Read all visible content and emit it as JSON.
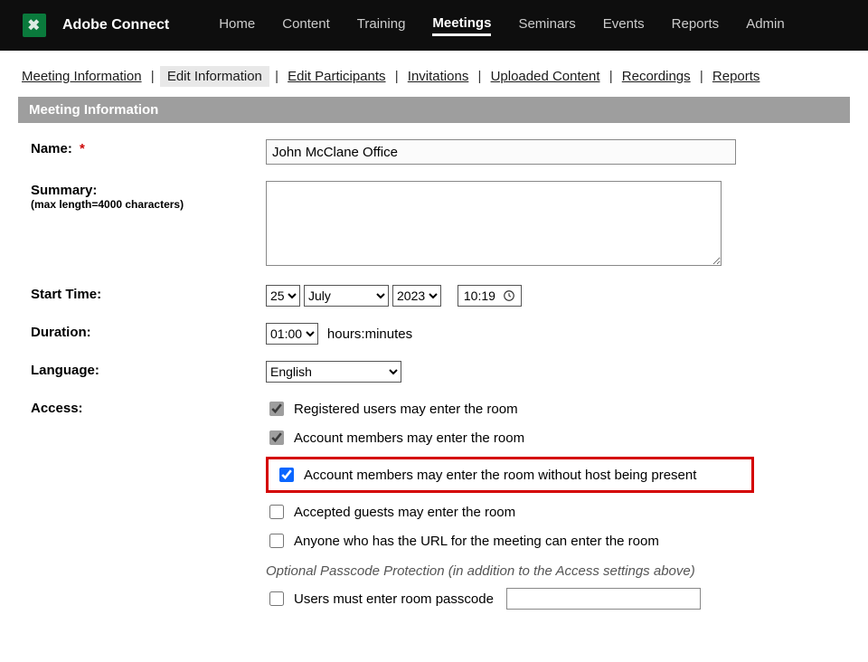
{
  "brand": "Adobe Connect",
  "topnav": {
    "items": [
      {
        "label": "Home"
      },
      {
        "label": "Content"
      },
      {
        "label": "Training"
      },
      {
        "label": "Meetings"
      },
      {
        "label": "Seminars"
      },
      {
        "label": "Events"
      },
      {
        "label": "Reports"
      },
      {
        "label": "Admin"
      }
    ],
    "active_index": 3
  },
  "subnav": {
    "items": [
      {
        "label": "Meeting Information"
      },
      {
        "label": "Edit Information"
      },
      {
        "label": "Edit Participants"
      },
      {
        "label": "Invitations"
      },
      {
        "label": "Uploaded Content"
      },
      {
        "label": "Recordings"
      },
      {
        "label": "Reports"
      }
    ],
    "current_index": 1,
    "separator": "|"
  },
  "section": {
    "title": "Meeting Information"
  },
  "form": {
    "labels": {
      "name": "Name:",
      "summary": "Summary:",
      "summary_sub": "(max length=4000 characters)",
      "start_time": "Start Time:",
      "duration": "Duration:",
      "language": "Language:",
      "access": "Access:"
    },
    "req_marker": "*",
    "values": {
      "name": "John McClane Office",
      "summary": ""
    },
    "start": {
      "day": "25",
      "month": "July",
      "year": "2023",
      "time": "10:19"
    },
    "duration": {
      "value": "01:00",
      "unit_label": "hours:minutes"
    },
    "language": {
      "value": "English"
    },
    "access": {
      "options": [
        {
          "label": "Registered users may enter the room",
          "checked": true,
          "style": "grey"
        },
        {
          "label": "Account members may enter the room",
          "checked": true,
          "style": "grey"
        },
        {
          "label": "Account members may enter the room without host being present",
          "checked": true,
          "style": "blue",
          "highlight": true
        },
        {
          "label": "Accepted guests may enter the room",
          "checked": false
        },
        {
          "label": "Anyone who has the URL for the meeting can enter the room",
          "checked": false
        }
      ],
      "optional_note": "Optional Passcode Protection (in addition to the Access settings above)",
      "passcode_label": "Users must enter room passcode",
      "passcode_checked": false,
      "passcode_value": ""
    }
  }
}
